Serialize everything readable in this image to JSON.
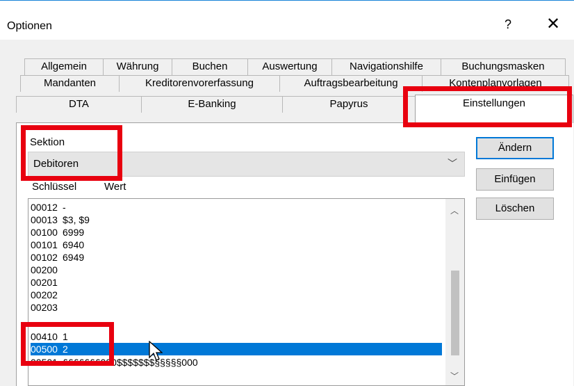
{
  "window": {
    "title": "Optionen",
    "help_glyph": "?",
    "close_glyph": "✕"
  },
  "tabs": {
    "row1": [
      "Allgemein",
      "Währung",
      "Buchen",
      "Auswertung",
      "Navigationshilfe",
      "Buchungsmasken"
    ],
    "row2": [
      "Mandanten",
      "Kreditorenvorerfassung",
      "Auftragsbearbeitung",
      "Kontenplanvorlagen"
    ],
    "row3": [
      "DTA",
      "E-Banking",
      "Papyrus",
      "Einstellungen"
    ]
  },
  "section": {
    "label": "Sektion",
    "value": "Debitoren"
  },
  "list": {
    "col_key": "Schlüssel",
    "col_value": "Wert",
    "rows": [
      {
        "key": "00012",
        "value": "-"
      },
      {
        "key": "00013",
        "value": "$3, $9"
      },
      {
        "key": "00100",
        "value": "6999"
      },
      {
        "key": "00101",
        "value": "6940"
      },
      {
        "key": "00102",
        "value": "6949"
      },
      {
        "key": "00200",
        "value": ""
      },
      {
        "key": "00201",
        "value": ""
      },
      {
        "key": "00202",
        "value": ""
      },
      {
        "key": "00203",
        "value": ""
      },
      {
        "key": "00410",
        "value": "1"
      },
      {
        "key": "00500",
        "value": "2"
      },
      {
        "key": "00501",
        "value": "£££££££000$$$$$$$§§§§§000"
      }
    ],
    "selected_key": "00500"
  },
  "buttons": {
    "change": "Ändern",
    "insert": "Einfügen",
    "delete": "Löschen"
  },
  "colors": {
    "selection": "#0078d7",
    "highlight": "#e8000f"
  }
}
